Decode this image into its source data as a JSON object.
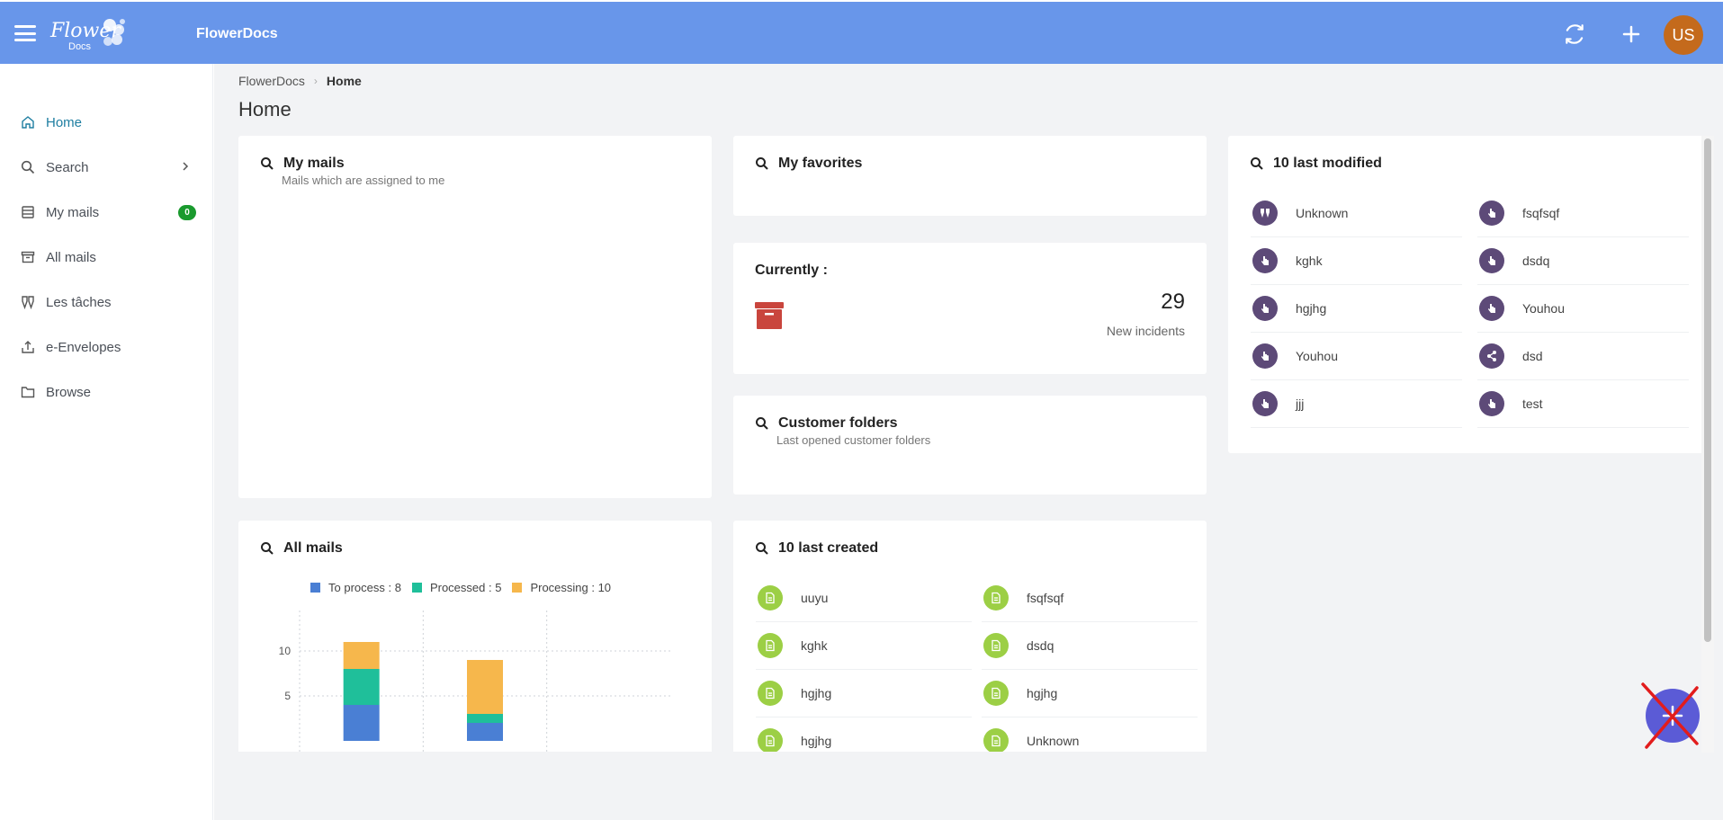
{
  "header": {
    "app_title": "FlowerDocs",
    "logo_text": "Flower",
    "logo_sub": "Docs",
    "avatar_initials": "US",
    "refresh_icon": "refresh-icon",
    "add_icon": "plus-icon",
    "menu_icon": "hamburger-menu-icon"
  },
  "sidebar": {
    "items": [
      {
        "label": "Home",
        "icon": "home-icon",
        "active": true
      },
      {
        "label": "Search",
        "icon": "search-icon",
        "chevron": ">"
      },
      {
        "label": "My mails",
        "icon": "inbox-icon",
        "badge": "0"
      },
      {
        "label": "All mails",
        "icon": "archive-icon"
      },
      {
        "label": "Les tâches",
        "icon": "tasks-icon"
      },
      {
        "label": "e-Envelopes",
        "icon": "envelope-upload-icon"
      },
      {
        "label": "Browse",
        "icon": "folder-icon"
      }
    ]
  },
  "breadcrumb": {
    "root": "FlowerDocs",
    "current": "Home"
  },
  "page_title": "Home",
  "cards": {
    "my_mails": {
      "title": "My mails",
      "subtitle": "Mails which are assigned to me"
    },
    "my_favorites": {
      "title": "My favorites"
    },
    "currently": {
      "title": "Currently :",
      "count": "29",
      "caption": "New incidents"
    },
    "customer_folders": {
      "title": "Customer folders",
      "subtitle": "Last opened customer folders"
    },
    "all_mails": {
      "title": "All mails"
    },
    "last_created": {
      "title": "10 last created",
      "items": [
        "uuyu",
        "fsqfsqf",
        "kghk",
        "dsdq",
        "hgjhg",
        "hgjhg",
        "hgjhg",
        "Unknown"
      ]
    },
    "last_modified": {
      "title": "10 last modified",
      "items": [
        {
          "label": "Unknown",
          "icon": "tasks-icon"
        },
        {
          "label": "fsqfsqf",
          "icon": "pointer-icon"
        },
        {
          "label": "kghk",
          "icon": "pointer-icon"
        },
        {
          "label": "dsdq",
          "icon": "pointer-icon"
        },
        {
          "label": "hgjhg",
          "icon": "pointer-icon"
        },
        {
          "label": "Youhou",
          "icon": "pointer-icon"
        },
        {
          "label": "Youhou",
          "icon": "pointer-icon"
        },
        {
          "label": "dsd",
          "icon": "share-icon"
        },
        {
          "label": "jjj",
          "icon": "pointer-icon"
        },
        {
          "label": "test",
          "icon": "pointer-icon"
        }
      ]
    }
  },
  "colors": {
    "header_bg": "#6896ea",
    "active_nav": "#1e7ea1",
    "badge_green": "#1a9a2e",
    "doc_green": "#9ccf45",
    "purple_icon": "#5d4a78",
    "incident_red": "#c9453d",
    "avatar_orange": "#c46a1c",
    "fab_purple": "#5b5bd6"
  },
  "chart_data": {
    "type": "bar",
    "stacked": true,
    "title": "",
    "categories": [
      "",
      "",
      ""
    ],
    "series": [
      {
        "name": "To process : 8",
        "color": "#4a7fd4",
        "values": [
          4,
          2,
          0
        ]
      },
      {
        "name": "Processed : 5",
        "color": "#1fbf9a",
        "values": [
          4,
          1,
          0
        ]
      },
      {
        "name": "Processing : 10",
        "color": "#f6b74c",
        "values": [
          3,
          6,
          0
        ]
      }
    ],
    "y_ticks": [
      "5",
      "10",
      "15"
    ],
    "ylim": [
      0,
      15
    ],
    "grid": true,
    "legend_position": "top"
  }
}
